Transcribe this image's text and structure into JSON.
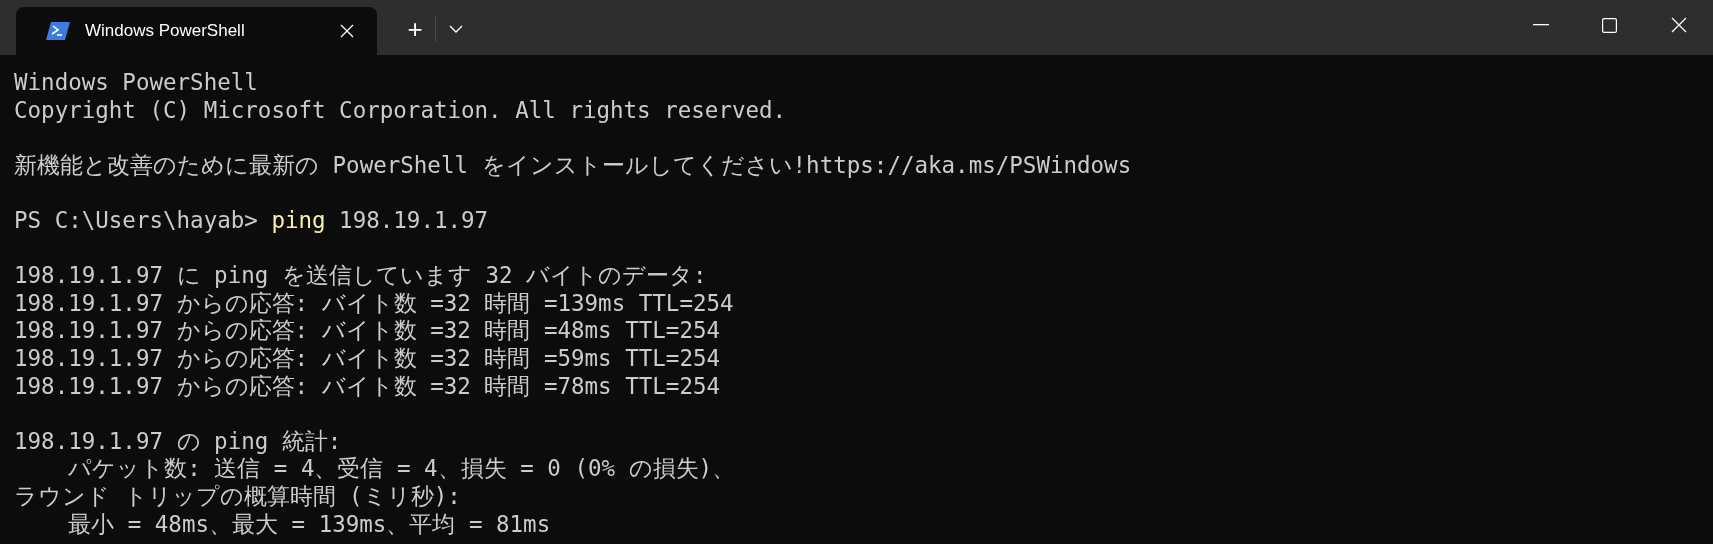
{
  "window": {
    "tabs": [
      {
        "title": "Windows PowerShell",
        "selected": true
      }
    ],
    "new_tab": "+"
  },
  "terminal": {
    "blocks": [
      [
        {
          "kind": "output",
          "text": "Windows PowerShell"
        },
        {
          "kind": "output",
          "text": "Copyright (C) Microsoft Corporation. All rights reserved."
        }
      ],
      [
        {
          "kind": "output",
          "text": "新機能と改善のために最新の PowerShell をインストールしてください!https://aka.ms/PSWindows"
        }
      ],
      [
        {
          "kind": "prompt",
          "prompt": "PS C:\\Users\\hayab> ",
          "command": "ping",
          "args": " 198.19.1.97"
        }
      ],
      [
        {
          "kind": "output",
          "text": "198.19.1.97 に ping を送信しています 32 バイトのデータ:"
        },
        {
          "kind": "output",
          "text": "198.19.1.97 からの応答: バイト数 =32 時間 =139ms TTL=254"
        },
        {
          "kind": "output",
          "text": "198.19.1.97 からの応答: バイト数 =32 時間 =48ms TTL=254"
        },
        {
          "kind": "output",
          "text": "198.19.1.97 からの応答: バイト数 =32 時間 =59ms TTL=254"
        },
        {
          "kind": "output",
          "text": "198.19.1.97 からの応答: バイト数 =32 時間 =78ms TTL=254"
        }
      ],
      [
        {
          "kind": "output",
          "text": "198.19.1.97 の ping 統計:"
        },
        {
          "kind": "output",
          "text": "    パケット数: 送信 = 4、受信 = 4、損失 = 0 (0% の損失)、"
        },
        {
          "kind": "output",
          "text": "ラウンド トリップの概算時間 (ミリ秒):"
        },
        {
          "kind": "output",
          "text": "    最小 = 48ms、最大 = 139ms、平均 = 81ms"
        }
      ]
    ]
  }
}
